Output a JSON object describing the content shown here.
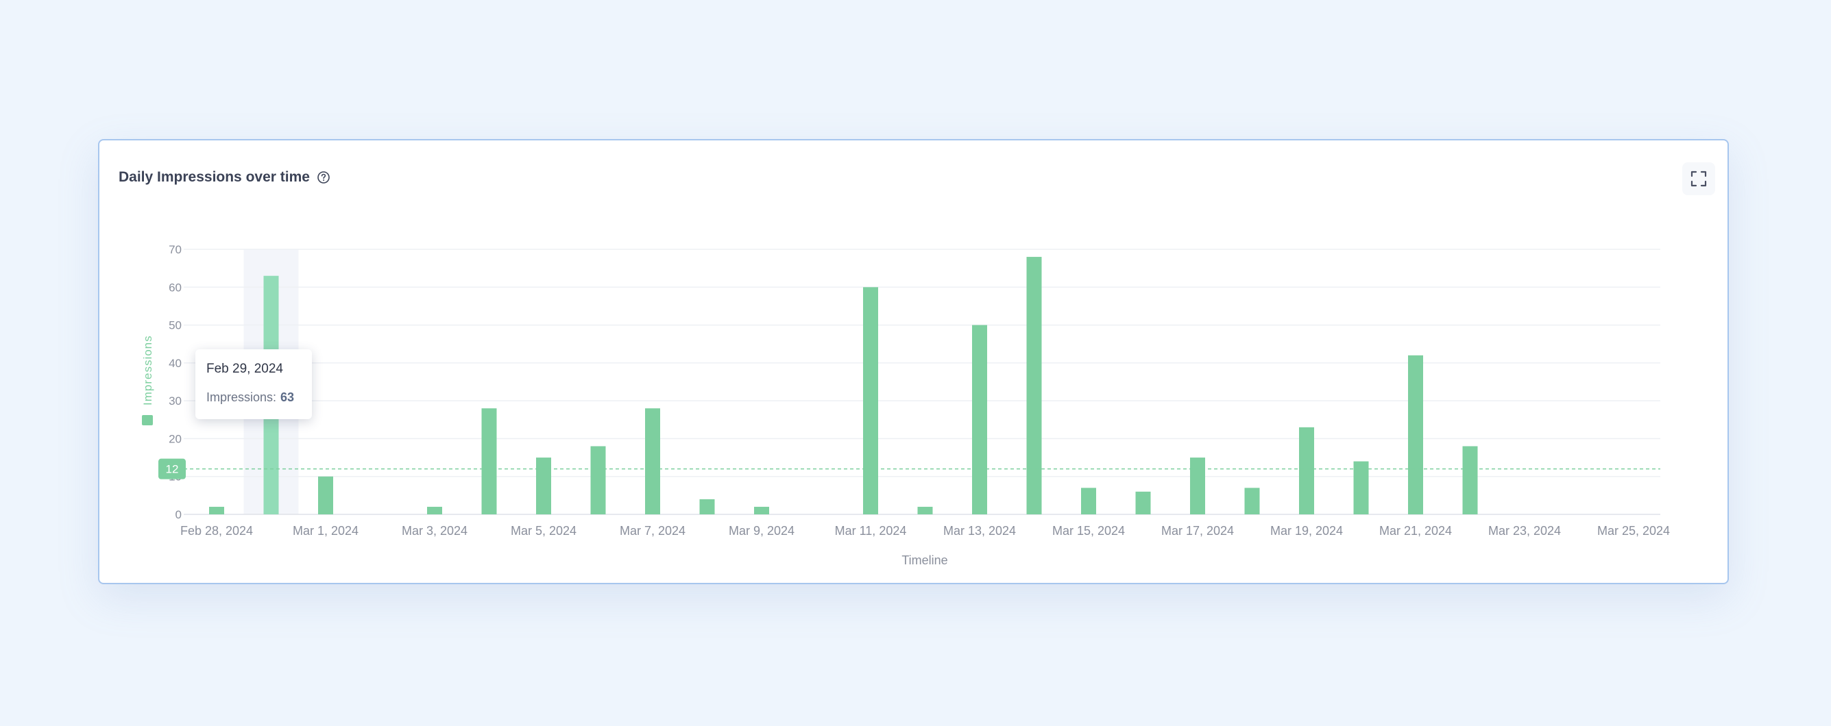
{
  "card": {
    "title": "Daily Impressions over time",
    "help_icon": "question-circle-icon",
    "expand_icon": "fullscreen-icon"
  },
  "tooltip": {
    "date": "Feb 29, 2024",
    "label": "Impressions:",
    "value": "63"
  },
  "colors": {
    "bar": "#7dcf9f",
    "bar_highlight": "#92dcb7",
    "hover_band": "#f3f5fa",
    "reference_line": "#7dcf9f",
    "grid": "#eef0f4",
    "axis_text": "#8a8f9c",
    "title": "#3b4256"
  },
  "chart_data": {
    "type": "bar",
    "xlabel": "Timeline",
    "ylabel": "Impressions",
    "ylim": [
      0,
      70
    ],
    "yticks": [
      0,
      10,
      20,
      30,
      40,
      50,
      60,
      70
    ],
    "grid": true,
    "legend": "left, vertical",
    "reference_line": {
      "value": 12,
      "label": "12"
    },
    "highlighted_category": "Feb 29, 2024",
    "xtick_labels": [
      "Feb 28, 2024",
      "Mar 1, 2024",
      "Mar 3, 2024",
      "Mar 5, 2024",
      "Mar 7, 2024",
      "Mar 9, 2024",
      "Mar 11, 2024",
      "Mar 13, 2024",
      "Mar 15, 2024",
      "Mar 17, 2024",
      "Mar 19, 2024",
      "Mar 21, 2024",
      "Mar 23, 2024",
      "Mar 25, 2024"
    ],
    "categories": [
      "Feb 28, 2024",
      "Feb 29, 2024",
      "Mar 1, 2024",
      "Mar 2, 2024",
      "Mar 3, 2024",
      "Mar 4, 2024",
      "Mar 5, 2024",
      "Mar 6, 2024",
      "Mar 7, 2024",
      "Mar 8, 2024",
      "Mar 9, 2024",
      "Mar 10, 2024",
      "Mar 11, 2024",
      "Mar 12, 2024",
      "Mar 13, 2024",
      "Mar 14, 2024",
      "Mar 15, 2024",
      "Mar 16, 2024",
      "Mar 17, 2024",
      "Mar 18, 2024",
      "Mar 19, 2024",
      "Mar 20, 2024",
      "Mar 21, 2024",
      "Mar 22, 2024",
      "Mar 23, 2024",
      "Mar 24, 2024",
      "Mar 25, 2024",
      "Mar 26, 2024"
    ],
    "series": [
      {
        "name": "Impressions",
        "values": [
          2,
          63,
          10,
          0,
          2,
          28,
          15,
          18,
          28,
          4,
          2,
          0,
          60,
          2,
          50,
          68,
          7,
          6,
          15,
          7,
          23,
          14,
          42,
          18,
          0,
          0,
          0,
          0
        ]
      }
    ]
  }
}
